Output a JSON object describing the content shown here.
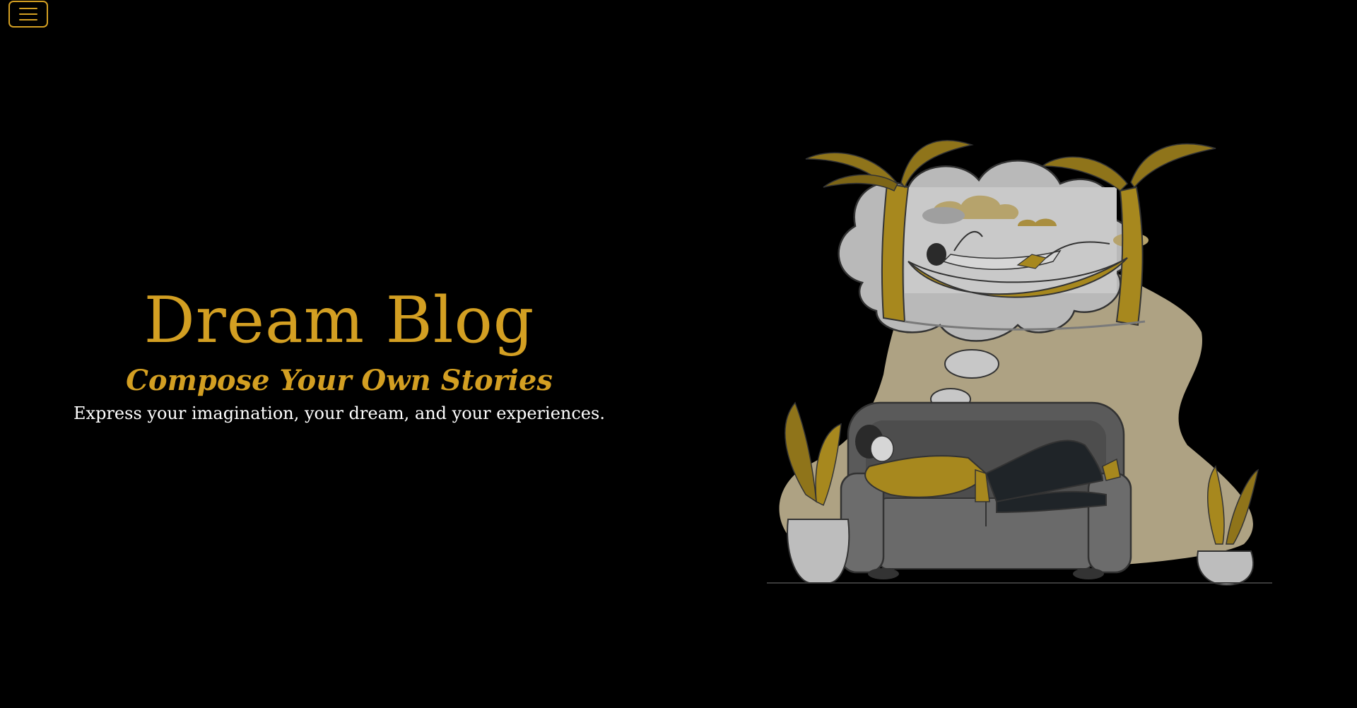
{
  "nav": {
    "toggle_icon": "hamburger-menu-icon",
    "accent_color": "#d39f22"
  },
  "hero": {
    "title": "Dream Blog",
    "subtitle": "Compose Your Own Stories",
    "tagline": "Express your imagination, your dream, and your experiences."
  },
  "theme": {
    "background": "#000000",
    "accent": "#d39f22",
    "text": "#ffffff"
  }
}
